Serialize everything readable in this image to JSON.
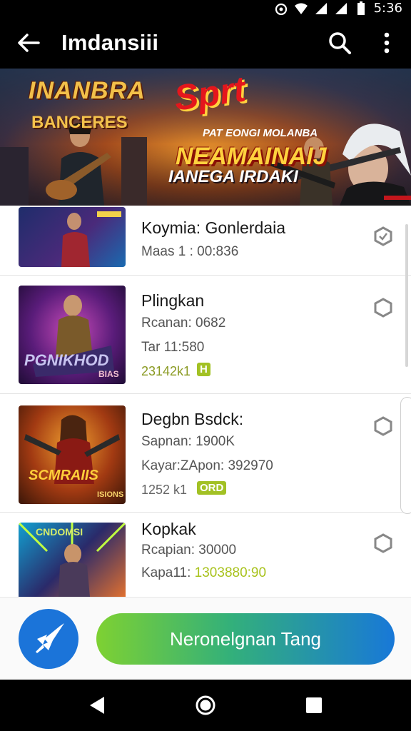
{
  "status_bar": {
    "time": "5:36"
  },
  "app_bar": {
    "title": "Imdansiii"
  },
  "banner": {
    "logo_line_1": "INANBRA",
    "logo_line_2": "BANCERES",
    "top_word": "Sprt",
    "mid_tag": "PAT EONGI MOLANBA",
    "headline": "NEAMAINAIJ",
    "low_tag": "IANEGA IRDAKI"
  },
  "games": [
    {
      "name": "Koymia: Gonlerdaia",
      "meta_1": "Maas 1 : 00:836"
    },
    {
      "name": "Plingkan",
      "meta_1": "Rcanan:  0682",
      "meta_2": "Tar 11:580",
      "badge_num": "23142k1",
      "badge": "H",
      "thumb_text": "PGNIKHOD",
      "thumb_sub": "BIAS"
    },
    {
      "name": "Degbn Bsdck:",
      "meta_1": "Sapnan: 1900K",
      "meta_2": "Kayar:ZApon: 392970",
      "badge_num": "1252 k1",
      "badge": "ORD",
      "thumb_text": "SCMRAIIS",
      "thumb_sub": "ISIONS"
    },
    {
      "name": "Kopkak",
      "meta_1": "Rcapian: 30000",
      "meta_2": "Kapa11:",
      "meta_2_highlight": "1303880:90",
      "thumb_text": "CNDOMSI",
      "thumb_sub": ""
    }
  ],
  "action_bar": {
    "cta_label": "Neronelgnan Tang"
  },
  "colors": {
    "accent_blue": "#1b74d9",
    "badge_green": "#a2c124"
  },
  "icons": [
    "back-arrow-icon",
    "search-icon",
    "more-vert-icon",
    "hexagon-icon",
    "rocket-icon",
    "nav-back-icon",
    "nav-home-icon",
    "nav-recents-icon"
  ]
}
